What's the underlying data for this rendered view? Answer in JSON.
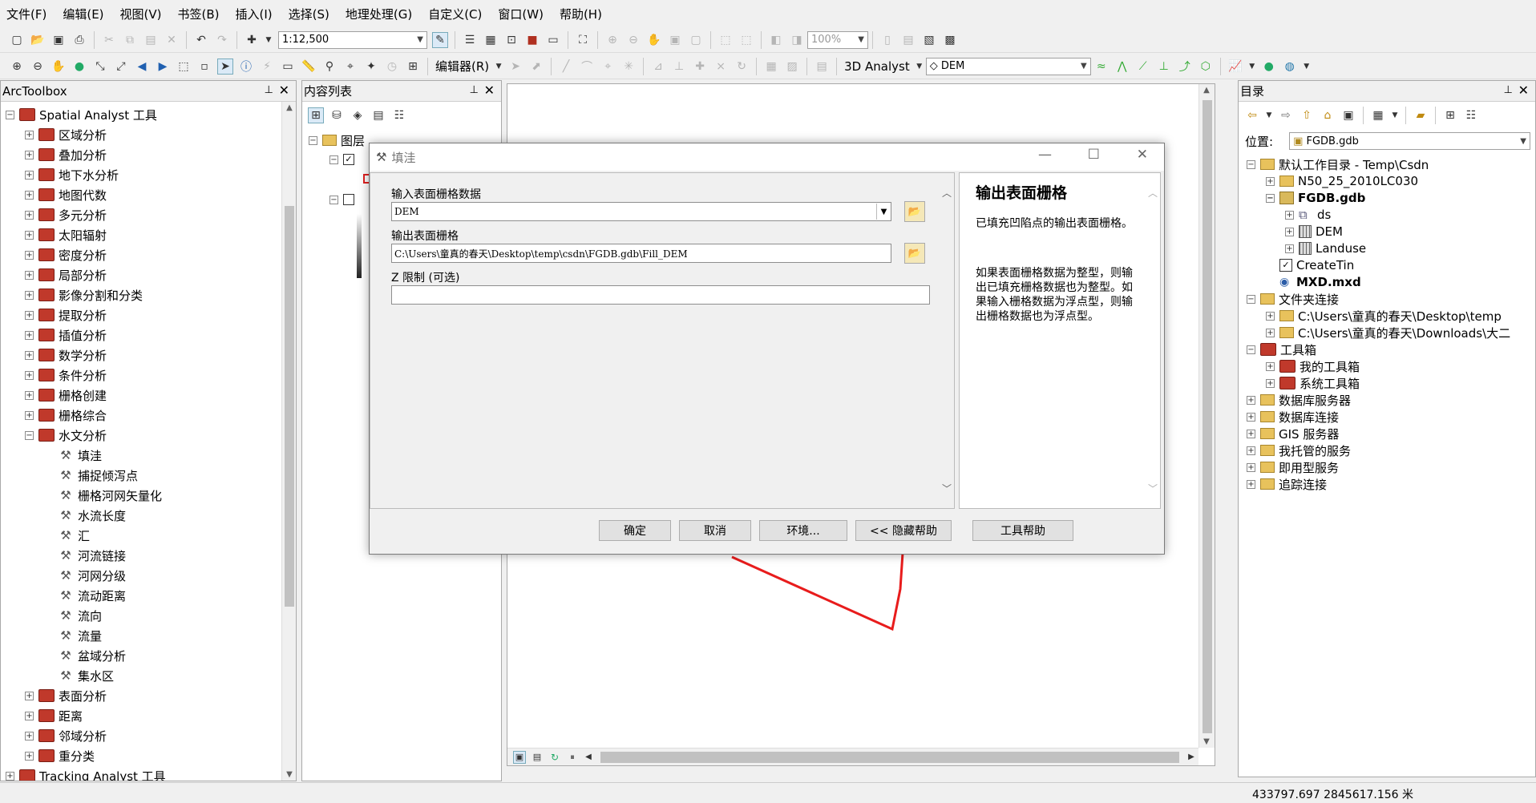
{
  "menu": [
    "文件(F)",
    "编辑(E)",
    "视图(V)",
    "书签(B)",
    "插入(I)",
    "选择(S)",
    "地理处理(G)",
    "自定义(C)",
    "窗口(W)",
    "帮助(H)"
  ],
  "toolbar": {
    "scale": "1:12,500",
    "zoom": "100%",
    "editor_label": "编辑器(R)",
    "analyst_label": "3D Analyst",
    "layer_combo": "DEM"
  },
  "arctoolbox": {
    "title": "ArcToolbox",
    "root": "Spatial Analyst 工具",
    "toolsets": [
      "区域分析",
      "叠加分析",
      "地下水分析",
      "地图代数",
      "多元分析",
      "太阳辐射",
      "密度分析",
      "局部分析",
      "影像分割和分类",
      "提取分析",
      "插值分析",
      "数学分析",
      "条件分析",
      "栅格创建",
      "栅格综合"
    ],
    "hydro": "水文分析",
    "hydro_tools": [
      "填洼",
      "捕捉倾泻点",
      "栅格河网矢量化",
      "水流长度",
      "汇",
      "河流链接",
      "河网分级",
      "流动距离",
      "流向",
      "流量",
      "盆域分析",
      "集水区"
    ],
    "after": [
      "表面分析",
      "距离",
      "邻域分析",
      "重分类"
    ],
    "tracking": "Tracking Analyst 工具"
  },
  "toc": {
    "title": "内容列表",
    "layers_label": "图层"
  },
  "dialog": {
    "title": "填洼",
    "input_label": "输入表面栅格数据",
    "input_value": "DEM",
    "output_label": "输出表面栅格",
    "output_value": "C:\\Users\\童真的春天\\Desktop\\temp\\csdn\\FGDB.gdb\\Fill_DEM",
    "z_label": "Z 限制 (可选)",
    "z_value": "",
    "help_title": "输出表面栅格",
    "help_p1": "已填充凹陷点的输出表面栅格。",
    "help_p2": "如果表面栅格数据为整型，则输出已填充栅格数据也为整型。如果输入栅格数据为浮点型，则输出栅格数据也为浮点型。",
    "buttons": {
      "ok": "确定",
      "cancel": "取消",
      "env": "环境...",
      "hide_help": "<< 隐藏帮助",
      "tool_help": "工具帮助"
    }
  },
  "catalog": {
    "title": "目录",
    "location_label": "位置:",
    "location_value": "FGDB.gdb",
    "items": {
      "home": "默认工作目录 - Temp\\Csdn",
      "n50": "N50_25_2010LC030",
      "fgdb": "FGDB.gdb",
      "ds": "ds",
      "dem": "DEM",
      "landuse": "Landuse",
      "createtin": "CreateTin",
      "mxd": "MXD.mxd",
      "folder_conn": "文件夹连接",
      "fc1": "C:\\Users\\童真的春天\\Desktop\\temp",
      "fc2": "C:\\Users\\童真的春天\\Downloads\\大二",
      "toolboxes": "工具箱",
      "my_tb": "我的工具箱",
      "sys_tb": "系统工具箱",
      "db_servers": "数据库服务器",
      "db_conn": "数据库连接",
      "gis_servers": "GIS 服务器",
      "hosted": "我托管的服务",
      "ready": "即用型服务",
      "tracking": "追踪连接"
    }
  },
  "status": {
    "coords": "433797.697  2845617.156 米"
  }
}
